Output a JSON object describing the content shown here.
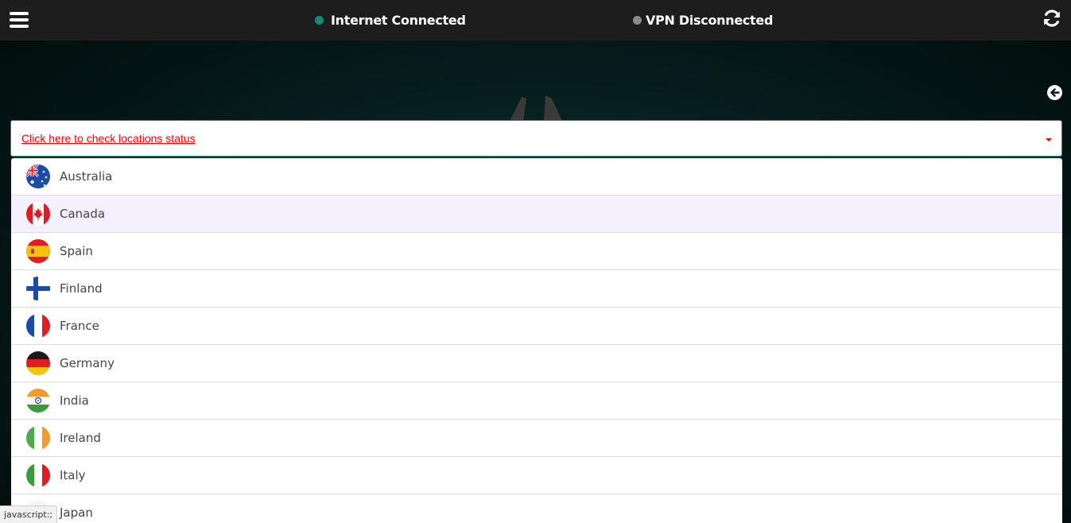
{
  "header": {
    "internet_status": "Internet Connected",
    "internet_dot_color": "#0f8a7a",
    "vpn_status": "VPN Disconnected",
    "vpn_dot_color": "#8a8a8a"
  },
  "location_select": {
    "prompt": "Click here to check locations status",
    "prompt_color": "#ff0000"
  },
  "locations": [
    {
      "name": "Australia",
      "flag": "australia-flag-icon"
    },
    {
      "name": "Canada",
      "flag": "canada-flag-icon"
    },
    {
      "name": "Spain",
      "flag": "spain-flag-icon"
    },
    {
      "name": "Finland",
      "flag": "finland-flag-icon"
    },
    {
      "name": "France",
      "flag": "france-flag-icon"
    },
    {
      "name": "Germany",
      "flag": "germany-flag-icon"
    },
    {
      "name": "India",
      "flag": "india-flag-icon"
    },
    {
      "name": "Ireland",
      "flag": "ireland-flag-icon"
    },
    {
      "name": "Italy",
      "flag": "italy-flag-icon"
    },
    {
      "name": "Japan",
      "flag": "japan-flag-icon"
    }
  ],
  "statusbar": {
    "text": "javascript:;"
  }
}
